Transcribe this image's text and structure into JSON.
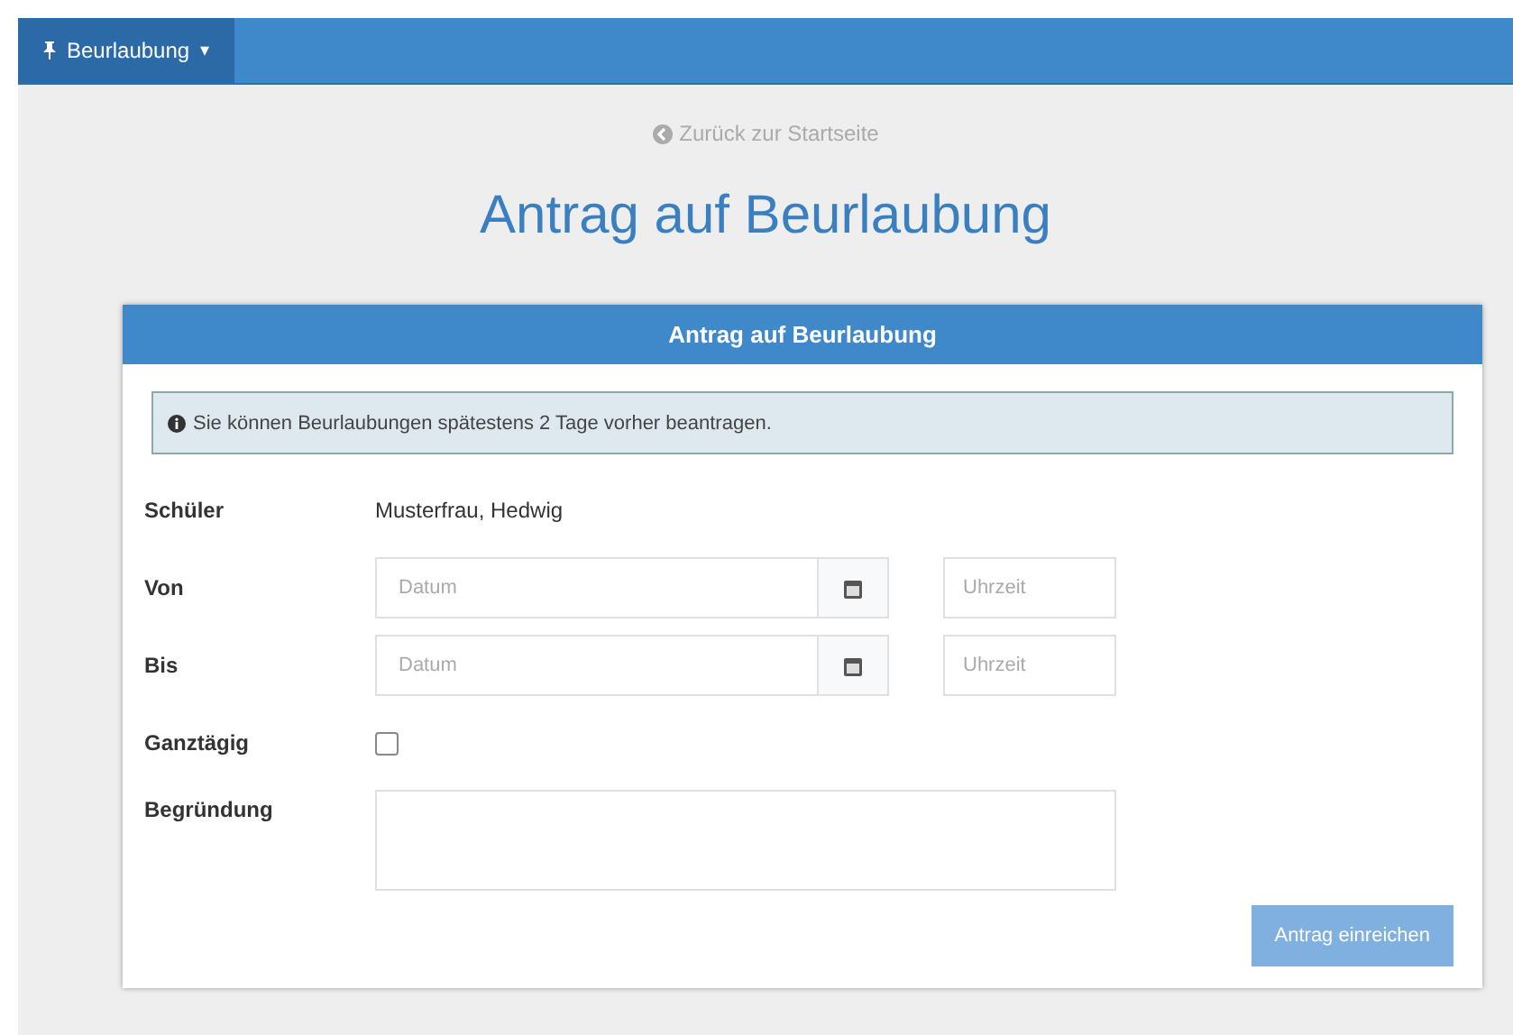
{
  "navbar": {
    "menu": {
      "label": "Beurlaubung",
      "caret": "▾"
    }
  },
  "back_link": "Zurück zur Startseite",
  "title": "Antrag auf Beurlaubung",
  "panel": {
    "heading": "Antrag auf Beurlaubung",
    "alert": "Sie können Beurlaubungen spätestens 2 Tage vorher beantragen.",
    "rows": [
      {
        "kind": "text",
        "label": "Schüler",
        "value": "Musterfrau, Hedwig"
      },
      {
        "kind": "datetime",
        "label": "Von",
        "date_placeholder": "Datum",
        "time_placeholder": "Uhrzeit"
      },
      {
        "kind": "datetime",
        "label": "Bis",
        "date_placeholder": "Datum",
        "time_placeholder": "Uhrzeit"
      },
      {
        "kind": "checkbox",
        "label": "Ganztägig",
        "checked": false
      },
      {
        "kind": "textarea",
        "label": "Begründung"
      }
    ],
    "submit": {
      "label": "Antrag einreichen",
      "disabled": true
    }
  }
}
